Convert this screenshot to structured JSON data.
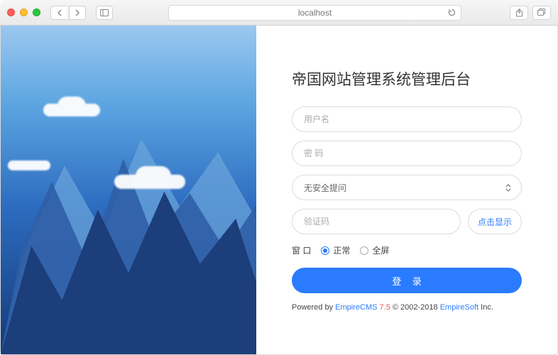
{
  "browser": {
    "address": "localhost"
  },
  "login": {
    "title": "帝国网站管理系统管理后台",
    "username_placeholder": "用户名",
    "password_placeholder": "密 码",
    "security_question_selected": "无安全提问",
    "captcha_placeholder": "验证码",
    "captcha_show_label": "点击显示",
    "window_label": "窗 口",
    "window_options": [
      {
        "label": "正常",
        "checked": true
      },
      {
        "label": "全屏",
        "checked": false
      }
    ],
    "submit_label": "登 录"
  },
  "footer": {
    "prefix": "Powered by ",
    "product": "EmpireCMS",
    "version": "7.5",
    "copyright_range": "© 2002-2018 ",
    "company": "EmpireSoft",
    "suffix": " Inc."
  }
}
